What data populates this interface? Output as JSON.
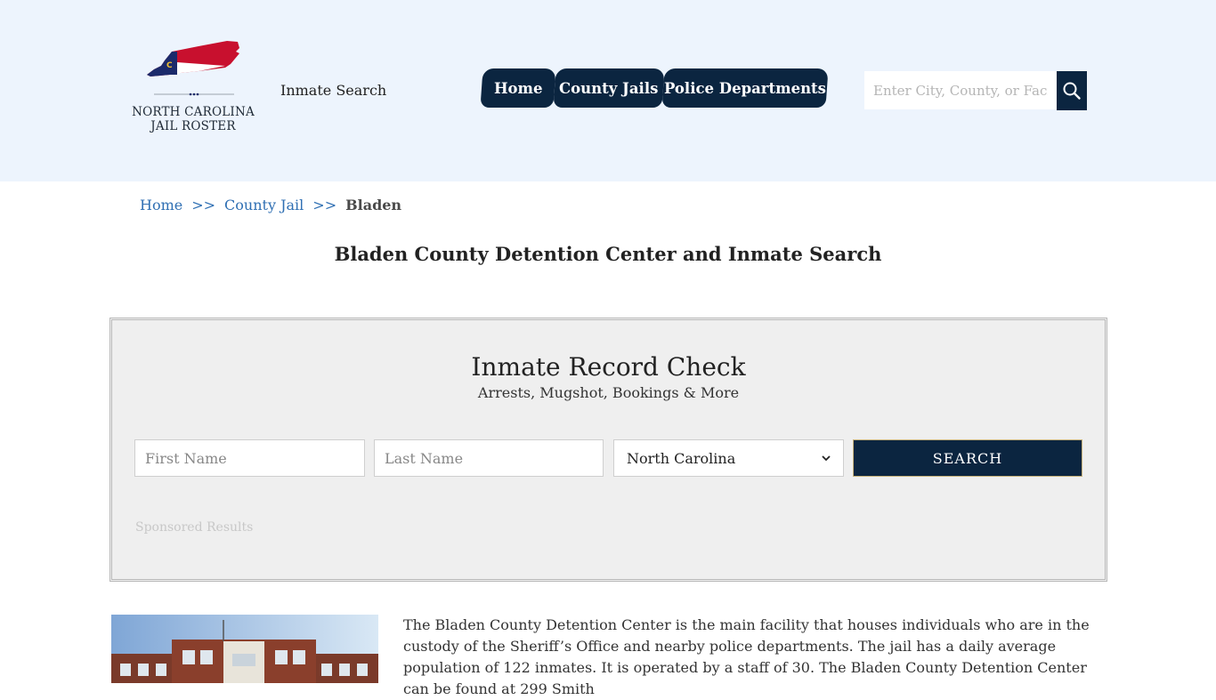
{
  "header": {
    "logo": {
      "line1": "NORTH CAROLINA",
      "line2": "JAIL ROSTER",
      "flag_colors": {
        "red": "#c8102e",
        "blue": "#1b2a6b",
        "gold": "#f2c230"
      }
    },
    "inmate_search_link": "Inmate Search",
    "nav": [
      {
        "label": "Home"
      },
      {
        "label": "County Jails"
      },
      {
        "label": "Police Departments"
      }
    ],
    "search": {
      "placeholder": "Enter City, County, or Facility",
      "icon": "search-icon"
    }
  },
  "breadcrumb": {
    "items": [
      "Home",
      "County Jail"
    ],
    "separator": ">>",
    "current": "Bladen"
  },
  "page_title": "Bladen County Detention Center and Inmate Search",
  "record_check": {
    "title": "Inmate Record Check",
    "subtitle": "Arrests, Mugshot, Bookings & More",
    "first_name_placeholder": "First Name",
    "last_name_placeholder": "Last Name",
    "state_selected": "North Carolina",
    "search_label": "SEARCH",
    "sponsored_label": "Sponsored Results"
  },
  "description": "The Bladen County Detention Center is the main facility that houses individuals who are in the custody of the Sheriff’s Office and nearby police departments. The jail has a daily average population of 122 inmates. It is operated by a staff of 30. The Bladen County Detention Center can be found at 299 Smith",
  "colors": {
    "header_bg": "#edf4fd",
    "navy": "#0b2540",
    "link_blue": "#2f6fb3",
    "panel_bg": "#efefef"
  }
}
